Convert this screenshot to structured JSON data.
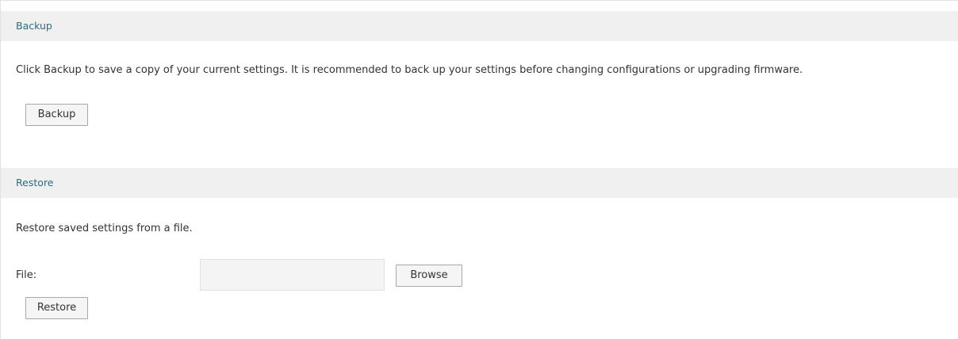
{
  "backup": {
    "header": "Backup",
    "description": "Click Backup to save a copy of your current settings. It is recommended to back up your settings before changing configurations or upgrading firmware.",
    "button_label": "Backup"
  },
  "restore": {
    "header": "Restore",
    "description": "Restore saved settings from a file.",
    "file_label": "File:",
    "file_value": "",
    "browse_label": "Browse",
    "button_label": "Restore"
  },
  "colors": {
    "header_text": "#2a6d7c",
    "header_bg": "#f0f0f0"
  }
}
